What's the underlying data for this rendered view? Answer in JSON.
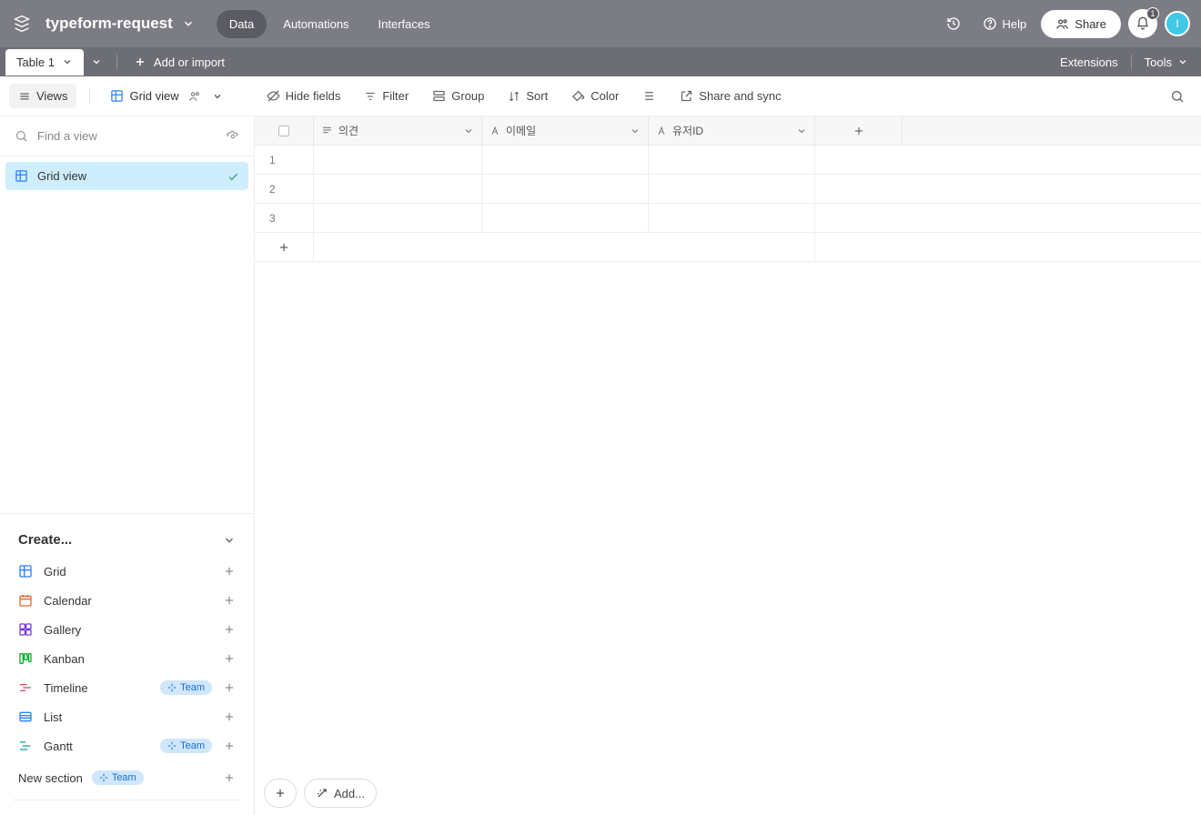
{
  "header": {
    "base_name": "typeform-request",
    "tabs": {
      "data": "Data",
      "automations": "Automations",
      "interfaces": "Interfaces"
    },
    "help": "Help",
    "share": "Share",
    "notifications_count": "1",
    "avatar_initial": "I"
  },
  "table_bar": {
    "table_name": "Table 1",
    "add_or_import": "Add or import",
    "extensions": "Extensions",
    "tools": "Tools"
  },
  "toolbar": {
    "views": "Views",
    "grid_view": "Grid view",
    "hide_fields": "Hide fields",
    "filter": "Filter",
    "group": "Group",
    "sort": "Sort",
    "color": "Color",
    "share_sync": "Share and sync"
  },
  "sidebar": {
    "find_placeholder": "Find a view",
    "views": [
      {
        "name": "Grid view"
      }
    ],
    "create_title": "Create...",
    "create_items": [
      {
        "name": "Grid",
        "icon": "grid",
        "color": "#2d7ff9",
        "team": false
      },
      {
        "name": "Calendar",
        "icon": "calendar",
        "color": "#e9682a",
        "team": false
      },
      {
        "name": "Gallery",
        "icon": "gallery",
        "color": "#7a3dd8",
        "team": false
      },
      {
        "name": "Kanban",
        "icon": "kanban",
        "color": "#11af22",
        "team": false
      },
      {
        "name": "Timeline",
        "icon": "timeline",
        "color": "#e04b66",
        "team": true
      },
      {
        "name": "List",
        "icon": "list",
        "color": "#2d7ff9",
        "team": false
      },
      {
        "name": "Gantt",
        "icon": "gantt",
        "color": "#15a89b",
        "team": true
      }
    ],
    "new_section": "New section",
    "team_label": "Team"
  },
  "grid": {
    "columns": [
      {
        "name": "의견",
        "type": "longtext"
      },
      {
        "name": "이메일",
        "type": "text"
      },
      {
        "name": "유저ID",
        "type": "text"
      }
    ],
    "rows": [
      "1",
      "2",
      "3"
    ],
    "footer_add": "Add..."
  }
}
